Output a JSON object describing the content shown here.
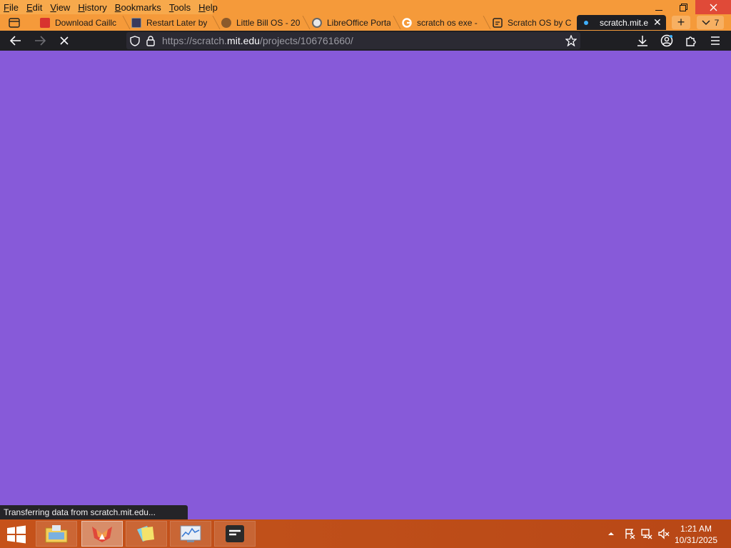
{
  "menu": {
    "items": [
      "File",
      "Edit",
      "View",
      "History",
      "Bookmarks",
      "Tools",
      "Help"
    ]
  },
  "window_controls": {
    "minimize": "minimize",
    "restore": "restore",
    "close": "close"
  },
  "tabs": [
    {
      "label": "Download Caillc",
      "icon": "red-favicon"
    },
    {
      "label": "Restart Later by",
      "icon": "monitor-favicon"
    },
    {
      "label": "Little Bill OS - 20",
      "icon": "character-favicon"
    },
    {
      "label": "LibreOffice Porta",
      "icon": "globe-favicon"
    },
    {
      "label": "scratch os exe -",
      "icon": "google-favicon"
    },
    {
      "label": "Scratch OS by C",
      "icon": "scratch-favicon"
    },
    {
      "label": "scratch.mit.e",
      "icon": "loading-dot",
      "active": true
    }
  ],
  "tab_overflow_count": "7",
  "navbar": {
    "url_prefix": "https://scratch.",
    "url_domain": "mit.edu",
    "url_suffix": "/projects/106761660/"
  },
  "status": {
    "text": "Transferring data from scratch.mit.edu..."
  },
  "taskbar": {
    "apps": [
      "file-explorer",
      "firefox-developer",
      "sticky-notes",
      "resource-monitor",
      "terminal-app"
    ],
    "time": "1:21 AM",
    "date": "10/31/2025"
  },
  "colors": {
    "page_background": "#875ad9",
    "menubar": "#f59a3a",
    "navbar": "#1f1f23",
    "taskbar": "#c0501a"
  }
}
